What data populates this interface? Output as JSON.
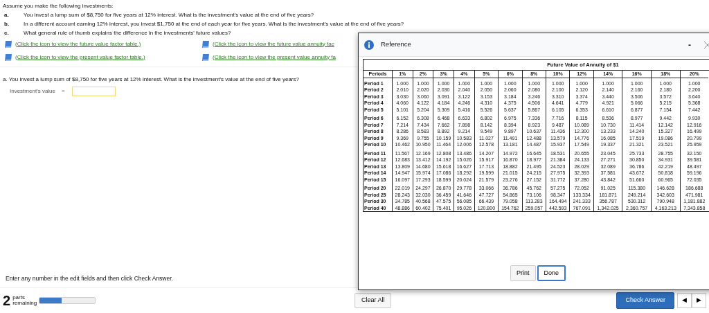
{
  "intro": "Assume you make the following investments:",
  "questions": [
    {
      "letter": "a.",
      "text": "You invest a lump sum of $8,750 for five years at 12% interest. What is the investment's value at the end of five years?"
    },
    {
      "letter": "b.",
      "text": "In a different account earning 12% interest, you invest $1,750 at the end of each year for five years. What is the investment's value at the end of five years?"
    },
    {
      "letter": "c.",
      "text": "What general rule of thumb explains the difference in the investments' future values?"
    }
  ],
  "table_links": [
    "(Click the icon to view the future value factor table.)",
    "(Click the icon to view the future value annuity fac",
    "(Click the icon to view the present value factor table.)",
    "(Click the icon to view the present value annuity fa"
  ],
  "part_a": {
    "question": "a. You invest a lump sum of $8,750 for five years at 12% interest. What is the investment's value at the end of five years?",
    "label": "Investment's value",
    "equals": "="
  },
  "instruction": "Enter any number in the edit fields and then click Check Answer.",
  "footer": {
    "count": "2",
    "count_label": "parts remaining",
    "level": 0.4,
    "clear": "Clear All",
    "check": "Check Answer",
    "prev": "◀",
    "next": "▶"
  },
  "reference": {
    "title": "Reference",
    "minimize": "-",
    "table_title": "Future Value of Annuity of $1",
    "columns": [
      "Periods",
      "1%",
      "2%",
      "3%",
      "4%",
      "5%",
      "6%",
      "8%",
      "10%",
      "12%",
      "14%",
      "16%",
      "18%",
      "20%"
    ],
    "row_groups": [
      [
        [
          "Period 1",
          "1.000",
          "1.000",
          "1.000",
          "1.000",
          "1.000",
          "1.000",
          "1.000",
          "1.000",
          "1.000",
          "1.000",
          "1.000",
          "1.000",
          "1.000"
        ],
        [
          "Period 2",
          "2.010",
          "2.020",
          "2.030",
          "2.040",
          "2.050",
          "2.060",
          "2.080",
          "2.100",
          "2.120",
          "2.140",
          "2.160",
          "2.180",
          "2.200"
        ],
        [
          "Period 3",
          "3.030",
          "3.060",
          "3.091",
          "3.122",
          "3.153",
          "3.184",
          "3.246",
          "3.310",
          "3.374",
          "3.440",
          "3.506",
          "3.572",
          "3.640"
        ],
        [
          "Period 4",
          "4.060",
          "4.122",
          "4.184",
          "4.246",
          "4.310",
          "4.375",
          "4.506",
          "4.641",
          "4.779",
          "4.921",
          "5.066",
          "5.215",
          "5.368"
        ],
        [
          "Period 5",
          "5.101",
          "5.204",
          "5.309",
          "5.416",
          "5.526",
          "5.637",
          "5.867",
          "6.105",
          "6.353",
          "6.610",
          "6.877",
          "7.154",
          "7.442"
        ]
      ],
      [
        [
          "Period 6",
          "6.152",
          "6.308",
          "6.468",
          "6.633",
          "6.802",
          "6.975",
          "7.336",
          "7.716",
          "8.115",
          "8.536",
          "8.977",
          "9.442",
          "9.930"
        ],
        [
          "Period 7",
          "7.214",
          "7.434",
          "7.662",
          "7.898",
          "8.142",
          "8.394",
          "8.923",
          "9.487",
          "10.089",
          "10.730",
          "11.414",
          "12.142",
          "12.916"
        ],
        [
          "Period 8",
          "8.286",
          "8.583",
          "8.892",
          "9.214",
          "9.549",
          "9.897",
          "10.637",
          "11.436",
          "12.300",
          "13.233",
          "14.240",
          "15.327",
          "16.499"
        ],
        [
          "Period 9",
          "9.369",
          "9.755",
          "10.159",
          "10.583",
          "11.027",
          "11.491",
          "12.488",
          "13.579",
          "14.776",
          "16.085",
          "17.519",
          "19.086",
          "20.799"
        ],
        [
          "Period 10",
          "10.462",
          "10.950",
          "11.464",
          "12.006",
          "12.578",
          "13.181",
          "14.487",
          "15.937",
          "17.549",
          "19.337",
          "21.321",
          "23.521",
          "25.959"
        ]
      ],
      [
        [
          "Period 11",
          "11.567",
          "12.169",
          "12.808",
          "13.486",
          "14.207",
          "14.972",
          "16.645",
          "18.531",
          "20.655",
          "23.045",
          "25.733",
          "28.755",
          "32.150"
        ],
        [
          "Period 12",
          "12.683",
          "13.412",
          "14.192",
          "15.026",
          "15.917",
          "16.870",
          "18.977",
          "21.384",
          "24.133",
          "27.271",
          "30.850",
          "34.931",
          "39.581"
        ],
        [
          "Period 13",
          "13.809",
          "14.680",
          "15.618",
          "16.627",
          "17.713",
          "18.882",
          "21.495",
          "24.523",
          "28.029",
          "32.089",
          "36.786",
          "42.219",
          "48.497"
        ],
        [
          "Period 14",
          "14.947",
          "15.974",
          "17.086",
          "18.292",
          "19.599",
          "21.015",
          "24.215",
          "27.975",
          "32.393",
          "37.581",
          "43.672",
          "50.818",
          "59.196"
        ],
        [
          "Period 15",
          "16.097",
          "17.293",
          "18.599",
          "20.024",
          "21.579",
          "23.276",
          "27.152",
          "31.772",
          "37.280",
          "43.842",
          "51.660",
          "60.965",
          "72.035"
        ]
      ],
      [
        [
          "Period 20",
          "22.019",
          "24.297",
          "26.870",
          "29.778",
          "33.066",
          "36.786",
          "45.762",
          "57.275",
          "72.052",
          "91.025",
          "115.380",
          "146.628",
          "186.688"
        ],
        [
          "Period 25",
          "28.243",
          "32.030",
          "36.459",
          "41.646",
          "47.727",
          "54.865",
          "73.106",
          "98.347",
          "133.334",
          "181.871",
          "249.214",
          "342.603",
          "471.981"
        ],
        [
          "Period 30",
          "34.785",
          "40.568",
          "47.575",
          "56.085",
          "66.439",
          "79.058",
          "113.283",
          "164.494",
          "241.333",
          "356.787",
          "530.312",
          "790.948",
          "1,181.882"
        ],
        [
          "Period 40",
          "48.886",
          "60.402",
          "75.401",
          "95.026",
          "120.800",
          "154.762",
          "259.057",
          "442.593",
          "767.091",
          "1,342.025",
          "2,360.757",
          "4,163.213",
          "7,343.858"
        ]
      ]
    ],
    "buttons": [
      {
        "label": "Print",
        "focused": false
      },
      {
        "label": "Done",
        "focused": true
      }
    ]
  }
}
